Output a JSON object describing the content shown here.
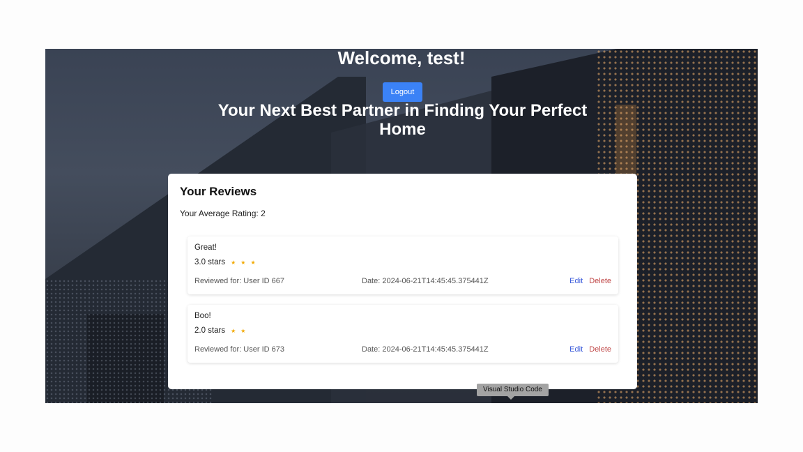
{
  "header": {
    "welcome": "Welcome, test!",
    "logout_label": "Logout",
    "tagline": "Your Next Best Partner in Finding Your Perfect Home"
  },
  "reviews_section": {
    "title": "Your Reviews",
    "average_label": "Your Average Rating: ",
    "average_value": "2",
    "reviews": [
      {
        "comment": "Great!",
        "rating_text": "3.0 stars",
        "rating": 3,
        "reviewed_for": "Reviewed for: User ID 667",
        "date": "Date: 2024-06-21T14:45:45.375441Z",
        "edit_label": "Edit",
        "delete_label": "Delete"
      },
      {
        "comment": "Boo!",
        "rating_text": "2.0 stars",
        "rating": 2,
        "reviewed_for": "Reviewed for: User ID 673",
        "date": "Date: 2024-06-21T14:45:45.375441Z",
        "edit_label": "Edit",
        "delete_label": "Delete"
      }
    ]
  },
  "tooltip": {
    "text": "Visual Studio Code"
  },
  "icons": {
    "star": "star-icon"
  },
  "colors": {
    "primary": "#3b82f6",
    "edit": "#3b5bdb",
    "delete": "#c04848",
    "star": "#f2a900"
  }
}
